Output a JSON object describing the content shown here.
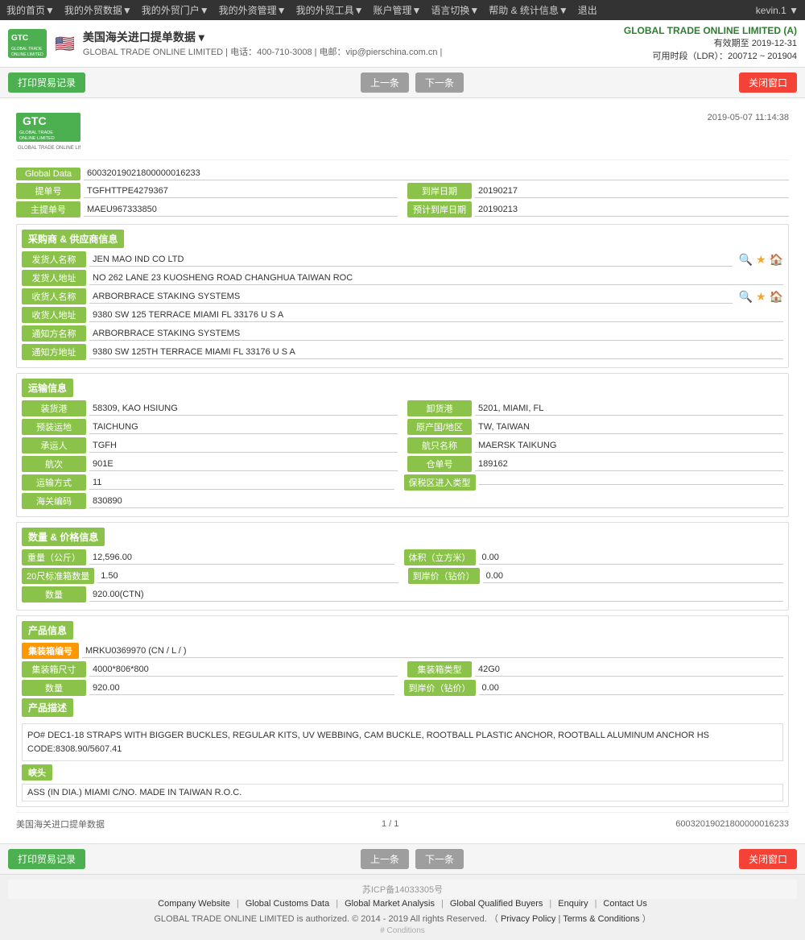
{
  "topnav": {
    "items": [
      "我的首页▼",
      "我的外贸数据▼",
      "我的外贸门户▼",
      "我的外资管理▼",
      "我的外贸工具▼",
      "账户管理▼",
      "语言切换▼",
      "帮助 & 统计信息▼",
      "退出"
    ],
    "user": "kevin.1 ▼"
  },
  "header": {
    "title": "美国海关进口提单数据 ▾",
    "subtitle": "GLOBAL TRADE ONLINE LIMITED | 电话：400-710-3008 | 电邮：vip@pierschina.com.cn |",
    "company": "GLOBAL TRADE ONLINE LIMITED (A)",
    "validity": "有效期至 2019-12-31",
    "ldr": "可用时段（LDR）：200712 ~ 201904"
  },
  "toolbar": {
    "print": "打印贸易记录",
    "prev": "上一条",
    "next": "下一条",
    "close": "关闭窗口"
  },
  "doc": {
    "timestamp": "2019-05-07 11:14:38",
    "logo_main": "GTC",
    "logo_sub": "GLOBAL TRADE ONLINE LIMITED",
    "global_data_label": "Global Data",
    "global_data_value": "60032019021800000016233",
    "bill_label": "提单号",
    "bill_value": "TGFHTTPE4279367",
    "arrival_date_label": "到岸日期",
    "arrival_date_value": "20190217",
    "master_bill_label": "主提单号",
    "master_bill_value": "MAEU967333850",
    "estimated_date_label": "预计到岸日期",
    "estimated_date_value": "20190213"
  },
  "buyer_supplier": {
    "section_label": "采购商 & 供应商信息",
    "shipper_name_label": "发货人名称",
    "shipper_name_value": "JEN MAO IND CO LTD",
    "shipper_addr_label": "发货人地址",
    "shipper_addr_value": "NO 262 LANE 23 KUOSHENG ROAD CHANGHUA TAIWAN ROC",
    "consignee_name_label": "收货人名称",
    "consignee_name_value": "ARBORBRACE STAKING SYSTEMS",
    "consignee_addr_label": "收货人地址",
    "consignee_addr_value": "9380 SW 125 TERRACE MIAMI FL 33176 U S A",
    "notify_name_label": "通知方名称",
    "notify_name_value": "ARBORBRACE STAKING SYSTEMS",
    "notify_addr_label": "通知方地址",
    "notify_addr_value": "9380 SW 125TH TERRACE MIAMI FL 33176 U S A"
  },
  "transport": {
    "section_label": "运输信息",
    "loading_port_label": "装货港",
    "loading_port_value": "58309, KAO HSIUNG",
    "discharge_port_label": "卸货港",
    "discharge_port_value": "5201, MIAMI, FL",
    "preloading_label": "预装运地",
    "preloading_value": "TAICHUNG",
    "origin_label": "原产国/地区",
    "origin_value": "TW, TAIWAN",
    "carrier_label": "承运人",
    "carrier_value": "TGFH",
    "vessel_label": "航只名称",
    "vessel_value": "MAERSK TAIKUNG",
    "voyage_label": "航次",
    "voyage_value": "901E",
    "manifest_label": "仓单号",
    "manifest_value": "189162",
    "transport_mode_label": "运输方式",
    "transport_mode_value": "11",
    "bonded_zone_label": "保税区进入类型",
    "bonded_zone_value": "",
    "customs_code_label": "海关编码",
    "customs_code_value": "830890"
  },
  "quantity_price": {
    "section_label": "数量 & 价格信息",
    "weight_label": "重量（公斤）",
    "weight_value": "12,596.00",
    "volume_label": "体积（立方米）",
    "volume_value": "0.00",
    "teu20_label": "20尺标准箱数量",
    "teu20_value": "1.50",
    "arrival_price_label": "到岸价（钻价）",
    "arrival_price_value": "0.00",
    "quantity_label": "数量",
    "quantity_value": "920.00(CTN)"
  },
  "product": {
    "section_label": "产品信息",
    "container_badge": "集装箱编号",
    "container_value": "MRKU0369970 (CN / L / )",
    "container_size_label": "集装箱尺寸",
    "container_size_value": "4000*806*800",
    "container_type_label": "集装箱类型",
    "container_type_value": "42G0",
    "quantity_label": "数量",
    "quantity_value": "920.00",
    "arrival_price_label": "到岸价（钻价）",
    "arrival_price_value": "0.00",
    "product_desc_label": "产品描述",
    "product_desc_value": "PO# DEC1-18 STRAPS WITH BIGGER BUCKLES, REGULAR KITS, UV WEBBING, CAM BUCKLE, ROOTBALL PLASTIC ANCHOR, ROOTBALL ALUMINUM ANCHOR HS CODE:8308.90/5607.41",
    "remark_label": "峡头",
    "remark_value": "ASS (IN DIA.) MIAMI C/NO. MADE IN TAIWAN R.O.C."
  },
  "doc_footer": {
    "label": "美国海关进口提单数据",
    "page": "1 / 1",
    "record_id": "60032019021800000016233"
  },
  "page_footer": {
    "icp": "苏ICP备14033305号",
    "links": [
      "Company Website",
      "Global Customs Data",
      "Global Market Analysis",
      "Global Qualified Buyers",
      "Enquiry",
      "Contact Us"
    ],
    "copyright": "GLOBAL TRADE ONLINE LIMITED is authorized. © 2014 - 2019 All rights Reserved. （",
    "privacy": "Privacy Policy",
    "terms": "Terms & Conditions",
    "copyright_end": "）",
    "conditions_label": "# Conditions"
  }
}
